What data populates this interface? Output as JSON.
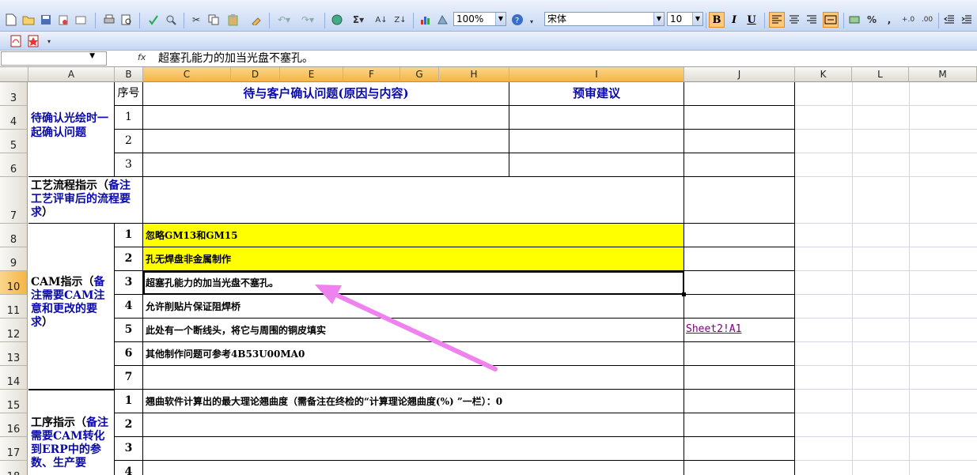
{
  "toolbar": {
    "zoom": "100%",
    "font_name": "宋体",
    "font_size": "10",
    "bold": "B",
    "italic": "I",
    "underline": "U",
    "sigma": "Σ",
    "percent": "%",
    "comma": ","
  },
  "formula_bar": {
    "fx": "fx",
    "content": "超塞孔能力的加当光盘不塞孔。"
  },
  "columns": [
    "A",
    "B",
    "C",
    "D",
    "E",
    "F",
    "G",
    "H",
    "I",
    "J",
    "K",
    "L",
    "M"
  ],
  "rows": [
    "3",
    "4",
    "5",
    "6",
    "7",
    "8",
    "9",
    "10",
    "11",
    "12",
    "13",
    "14",
    "15",
    "16",
    "17",
    "18"
  ],
  "cells": {
    "a3": "待确认光绘时一起确认问题",
    "b3": "序号",
    "c3": "待与客户确认问题(原因与内容)",
    "i3": "预审建议",
    "b4": "1",
    "b5": "2",
    "b6": "3",
    "a7_black": "工艺流程指示（",
    "a7_blue": "备注工艺评审后的流程要求",
    "a7_close": "）",
    "a8_black": "CAM指示（",
    "a8_blue": "备注需要CAM注意和更改的要求",
    "a8_close": "）",
    "b8": "1",
    "b9": "2",
    "b10": "3",
    "b11": "4",
    "b12": "5",
    "b13": "6",
    "b14": "7",
    "c8": "忽略GM13和GM15",
    "c9": "孔无焊盘非金属制作",
    "c10": "超塞孔能力的加当光盘不塞孔。",
    "c11": "允许削贴片保证阻焊桥",
    "c12": "此处有一个断线头，将它与周围的铜皮填实",
    "c13": "其他制作问题可参考4B53U00MA0",
    "j12": "Sheet2!A1",
    "a15_black": "工序指示（",
    "a15_blue": "备注需要CAM转化到ERP中的参数、生产要",
    "b15": "1",
    "b16": "2",
    "b17": "3",
    "b18": "4",
    "c15": "翘曲软件计算出的最大理论翘曲度（需备注在终检的“计算理论翘曲度(%) ”一栏）：0"
  },
  "colors": {
    "highlight_yellow": "#ffff00",
    "text_blue": "#0a0aa8",
    "arrow_pink": "#ee82ee",
    "selected_header": "#f5b545"
  }
}
